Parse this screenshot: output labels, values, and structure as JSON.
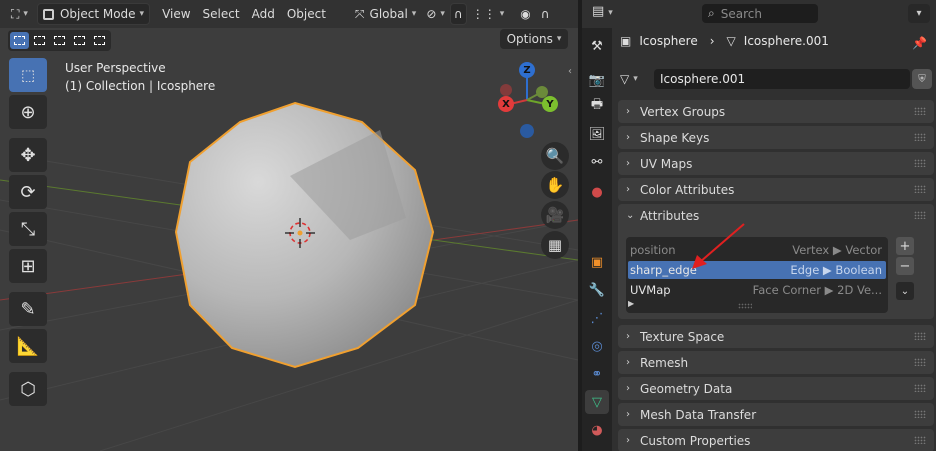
{
  "viewport_header": {
    "mode": "Object Mode",
    "menus": [
      "View",
      "Select",
      "Add",
      "Object"
    ],
    "transform_orientation": "Global"
  },
  "options_label": "Options",
  "viewport_info": {
    "perspective": "User Perspective",
    "collection": "(1) Collection | Icosphere"
  },
  "gizmo": {
    "z": "Z",
    "x": "X",
    "y": "Y"
  },
  "props_header": {
    "search_placeholder": "Search"
  },
  "breadcrumb": {
    "object": "Icosphere",
    "mesh": "Icosphere.001"
  },
  "data_name": "Icosphere.001",
  "panels_top": [
    {
      "label": "Vertex Groups"
    },
    {
      "label": "Shape Keys"
    },
    {
      "label": "UV Maps"
    },
    {
      "label": "Color Attributes"
    },
    {
      "label": "Attributes"
    }
  ],
  "attributes": [
    {
      "name": "position",
      "desc": "Vertex ▶ Vector"
    },
    {
      "name": "sharp_edge",
      "desc": "Edge ▶ Boolean"
    },
    {
      "name": "UVMap",
      "desc": "Face Corner ▶ 2D Ve..."
    }
  ],
  "panels_bottom": [
    {
      "label": "Texture Space"
    },
    {
      "label": "Remesh"
    },
    {
      "label": "Geometry Data"
    },
    {
      "label": "Mesh Data Transfer"
    },
    {
      "label": "Custom Properties"
    }
  ],
  "colors": {
    "accent": "#4772b3",
    "selection_outline": "#f0a030",
    "annotation_arrow": "#e02020"
  }
}
